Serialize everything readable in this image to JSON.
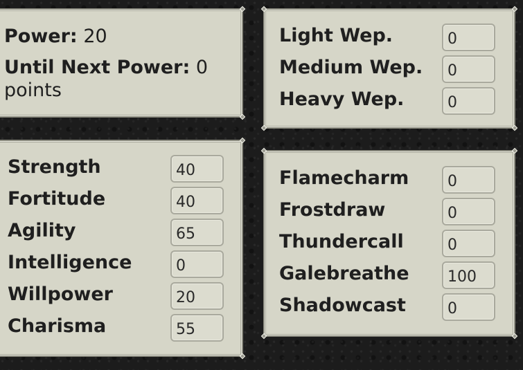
{
  "power_panel": {
    "power_label": "Power:",
    "power_value": "20",
    "until_label": "Until Next Power:",
    "until_value": "0",
    "until_unit": "points"
  },
  "weapons": [
    {
      "label": "Light Wep.",
      "value": "0"
    },
    {
      "label": "Medium Wep.",
      "value": "0"
    },
    {
      "label": "Heavy Wep.",
      "value": "0"
    }
  ],
  "stats": [
    {
      "label": "Strength",
      "value": "40"
    },
    {
      "label": "Fortitude",
      "value": "40"
    },
    {
      "label": "Agility",
      "value": "65"
    },
    {
      "label": "Intelligence",
      "value": "0"
    },
    {
      "label": "Willpower",
      "value": "20"
    },
    {
      "label": "Charisma",
      "value": "55"
    }
  ],
  "magic": [
    {
      "label": "Flamecharm",
      "value": "0"
    },
    {
      "label": "Frostdraw",
      "value": "0"
    },
    {
      "label": "Thundercall",
      "value": "0"
    },
    {
      "label": "Galebreathe",
      "value": "100"
    },
    {
      "label": "Shadowcast",
      "value": "0"
    }
  ]
}
